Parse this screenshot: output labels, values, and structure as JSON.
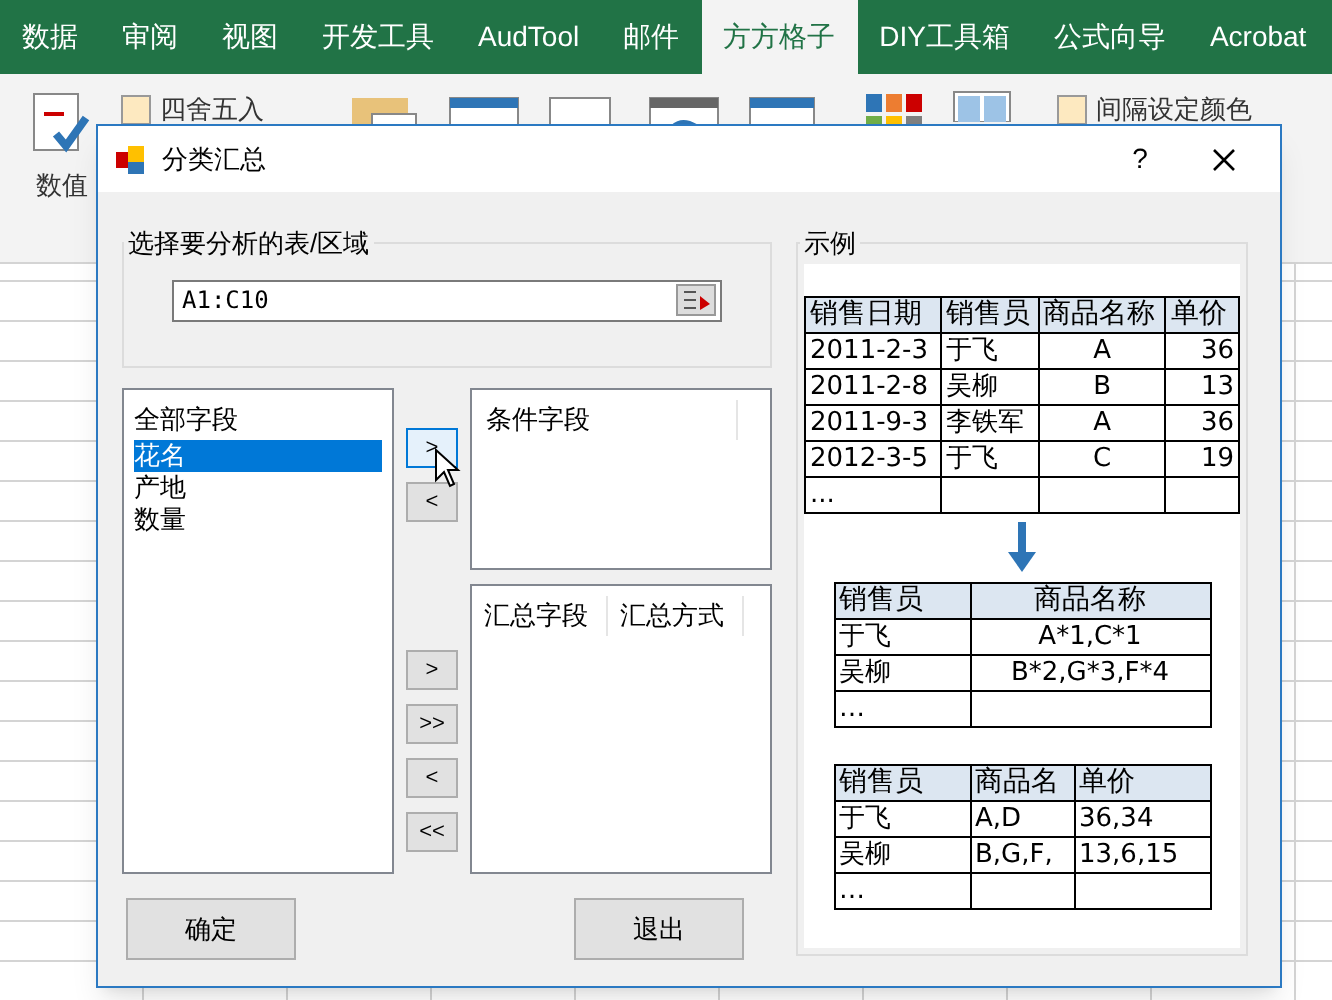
{
  "ribbon": {
    "tabs": [
      {
        "label": "数据",
        "selected": false
      },
      {
        "label": "审阅",
        "selected": false
      },
      {
        "label": "视图",
        "selected": false
      },
      {
        "label": "开发工具",
        "selected": false
      },
      {
        "label": "AudTool",
        "selected": false
      },
      {
        "label": "邮件",
        "selected": false
      },
      {
        "label": "方方格子",
        "selected": true
      },
      {
        "label": "DIY工具箱",
        "selected": false
      },
      {
        "label": "公式向导",
        "selected": false
      },
      {
        "label": "Acrobat",
        "selected": false
      }
    ],
    "commands": [
      "四舍五入",
      "间隔设定颜色"
    ],
    "group_label": "数值"
  },
  "dialog": {
    "title": "分类汇总",
    "help": "?",
    "range_group": {
      "label": "选择要分析的表/区域",
      "value": "A1:C10"
    },
    "all_fields": {
      "header": "全部字段",
      "items": [
        {
          "label": "花名",
          "selected": true
        },
        {
          "label": "产地",
          "selected": false
        },
        {
          "label": "数量",
          "selected": false
        }
      ]
    },
    "condition_buttons": [
      {
        "label": ">",
        "highlighted": true
      },
      {
        "label": "<",
        "highlighted": false
      }
    ],
    "condition_list": {
      "columns": [
        "条件字段"
      ]
    },
    "summary_buttons": [
      {
        "label": ">",
        "highlighted": false
      },
      {
        "label": ">>",
        "highlighted": false
      },
      {
        "label": "<",
        "highlighted": false
      },
      {
        "label": "<<",
        "highlighted": false
      }
    ],
    "summary_list": {
      "columns": [
        "汇总字段",
        "汇总方式"
      ]
    },
    "buttons": [
      "确定",
      "退出"
    ],
    "example": {
      "label": "示例",
      "tables": [
        {
          "columns": [
            {
              "label": "销售日期",
              "kind": "text"
            },
            {
              "label": "销售员",
              "kind": "text"
            },
            {
              "label": "商品名称",
              "kind": "code"
            },
            {
              "label": "单价",
              "kind": "number"
            }
          ],
          "rows": [
            [
              "2011-2-3",
              "于飞",
              "A",
              "36"
            ],
            [
              "2011-2-8",
              "吴柳",
              "B",
              "13"
            ],
            [
              "2011-9-3",
              "李铁军",
              "A",
              "36"
            ],
            [
              "2012-3-5",
              "于飞",
              "C",
              "19"
            ],
            [
              "...",
              "",
              "",
              ""
            ]
          ]
        },
        {
          "columns": [
            {
              "label": "销售员",
              "kind": "text"
            },
            {
              "label": "商品名称",
              "kind": "code"
            }
          ],
          "rows": [
            [
              "于飞",
              "A*1,C*1"
            ],
            [
              "吴柳",
              "B*2,G*3,F*4"
            ],
            [
              "…",
              ""
            ]
          ]
        },
        {
          "columns": [
            {
              "label": "销售员",
              "kind": "text"
            },
            {
              "label": "商品名",
              "kind": "text"
            },
            {
              "label": "单价",
              "kind": "text"
            }
          ],
          "rows": [
            [
              "于飞",
              "A,D",
              "36,34"
            ],
            [
              "吴柳",
              "B,G,F,",
              "13,6,15"
            ],
            [
              "…",
              "",
              ""
            ]
          ]
        }
      ]
    }
  }
}
